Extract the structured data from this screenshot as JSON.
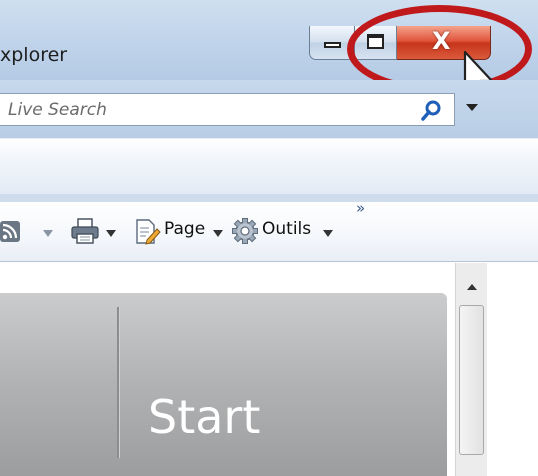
{
  "window": {
    "title_fragment": "xplorer",
    "controls": {
      "minimize": "minimize",
      "maximize": "maximize",
      "close": "close"
    },
    "close_label": "X",
    "accent_close": "#c7351c",
    "annotation_color": "#c0191c"
  },
  "search": {
    "placeholder": "Live Search",
    "icon": "search-icon",
    "dropdown_icon": "chevron-down-icon"
  },
  "command_bar": {
    "feeds_icon": "rss-icon",
    "print_icon": "printer-icon",
    "page_icon": "page-icon",
    "page_label": "Page",
    "tools_icon": "gear-icon",
    "tools_label": "Outils",
    "overflow_label": "»"
  },
  "content": {
    "tile_label": "Start"
  }
}
